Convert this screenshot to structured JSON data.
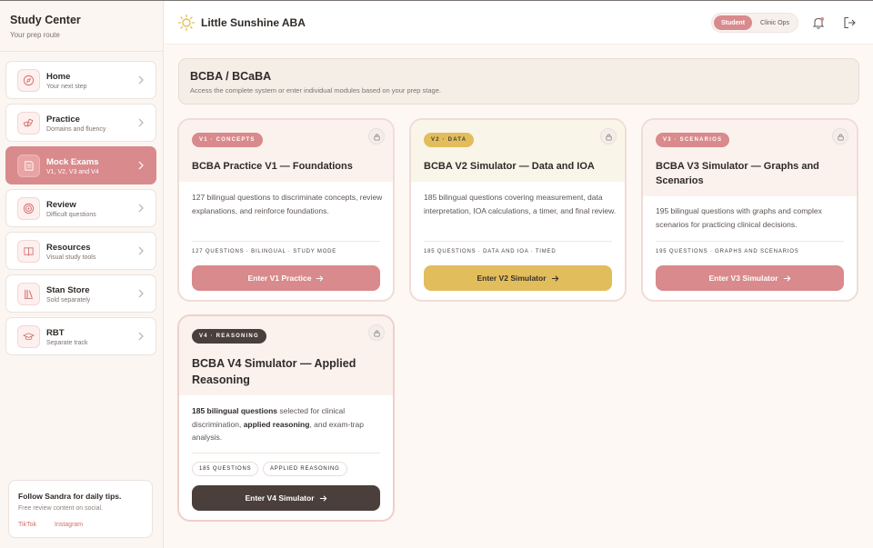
{
  "sidebar": {
    "title": "Study Center",
    "subtitle": "Your prep route",
    "items": [
      {
        "label": "Home",
        "sub": "Your next step",
        "icon": "compass-icon"
      },
      {
        "label": "Practice",
        "sub": "Domains and fluency",
        "icon": "practice-icon"
      },
      {
        "label": "Mock Exams",
        "sub": "V1, V2, V3 and V4",
        "icon": "exam-icon",
        "active": true
      },
      {
        "label": "Review",
        "sub": "Difficult questions",
        "icon": "target-icon"
      },
      {
        "label": "Resources",
        "sub": "Visual study tools",
        "icon": "book-icon"
      },
      {
        "label": "Stan Store",
        "sub": "Sold separately",
        "icon": "library-icon"
      },
      {
        "label": "RBT",
        "sub": "Separate track",
        "icon": "graduation-cap-icon"
      }
    ],
    "promo": {
      "title": "Follow Sandra for daily tips.",
      "subtitle": "Free review content on social.",
      "links": [
        "TikTok",
        "Instagram"
      ]
    }
  },
  "topbar": {
    "brand": "Little Sunshine ABA",
    "toggle": {
      "student": "Student",
      "clinic": "Clinic Ops",
      "selected": "Student"
    }
  },
  "header": {
    "title": "BCBA / BCaBA",
    "subtitle": "Access the complete system or enter individual modules based on your prep stage."
  },
  "cards": [
    {
      "pill": "V1 · CONCEPTS",
      "title": "BCBA Practice V1 — Foundations",
      "desc": "127 bilingual questions to discriminate concepts, review explanations, and reinforce foundations.",
      "meta": "127 QUESTIONS · BILINGUAL · STUDY MODE",
      "button": "Enter V1 Practice"
    },
    {
      "pill": "V2 · DATA",
      "title": "BCBA V2 Simulator — Data and IOA",
      "desc": "185 bilingual questions covering measurement, data interpretation, IOA calculations, a timer, and final review.",
      "meta": "185 QUESTIONS · DATA AND IOA · TIMED",
      "button": "Enter V2 Simulator"
    },
    {
      "pill": "V3 · SCENARIOS",
      "title": "BCBA V3 Simulator — Graphs and Scenarios",
      "desc": "195 bilingual questions with graphs and complex scenarios for practicing clinical decisions.",
      "meta": "195 QUESTIONS · GRAPHS AND SCENARIOS",
      "button": "Enter V3 Simulator"
    },
    {
      "pill": "V4 · REASONING",
      "title": "BCBA V4 Simulator — Applied Reasoning",
      "desc_bold1": "185 bilingual questions",
      "desc_mid": " selected for clinical discrimination, ",
      "desc_bold2": "applied reasoning",
      "desc_end": ", and exam-trap analysis.",
      "tags": [
        "185 QUESTIONS",
        "APPLIED REASONING"
      ],
      "button": "Enter V4 Simulator"
    }
  ],
  "colors": {
    "accent": "#d98a8c",
    "gold": "#e2bd5c",
    "dark": "#4a3f3a",
    "background": "#fdf8f4"
  }
}
